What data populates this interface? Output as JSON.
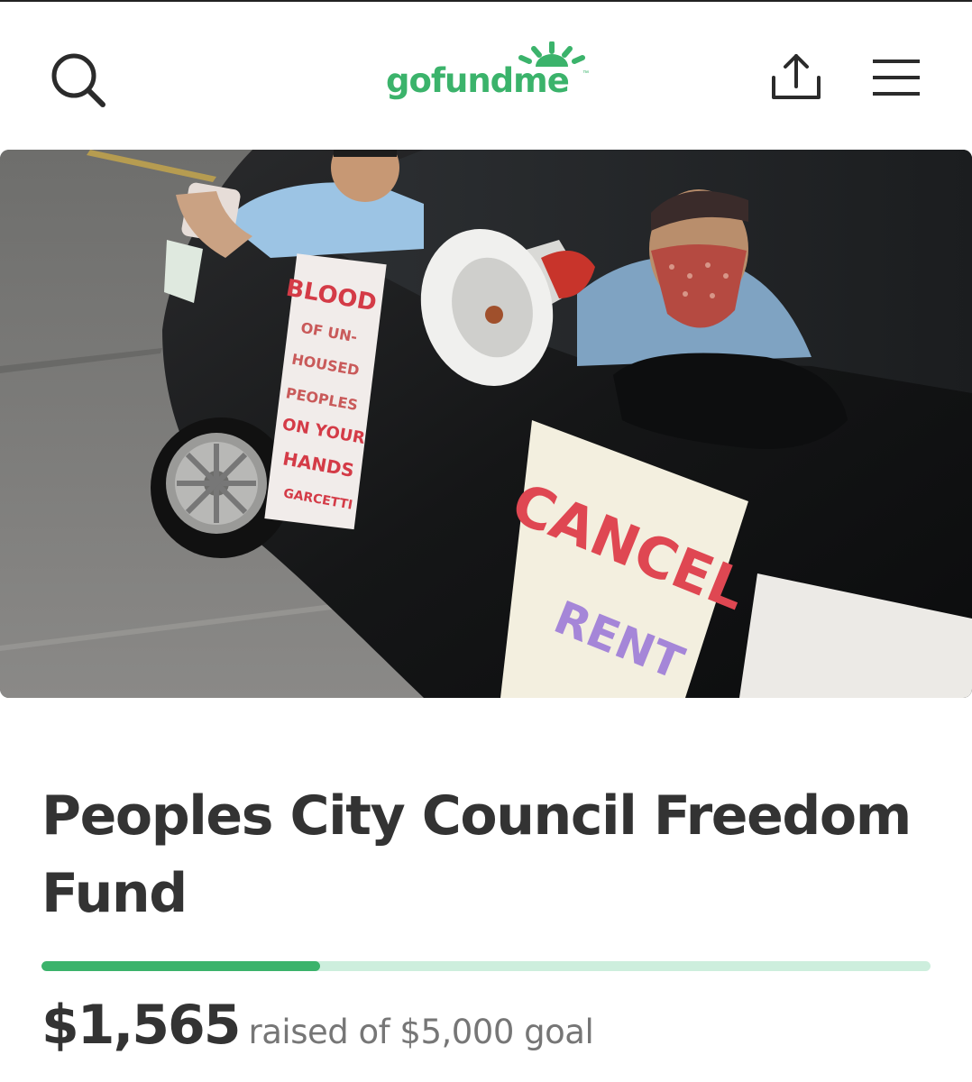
{
  "header": {
    "logo_text": "gofundme",
    "logo_tm": "™",
    "search_icon": "search-icon",
    "share_icon": "share-icon",
    "menu_icon": "hamburger-menu-icon"
  },
  "hero_image": {
    "signs": {
      "left_sign": [
        "BLOOD",
        "OF UN-",
        "HOUSED",
        "PEOPLES",
        "ON YOUR",
        "HANDS",
        "GARCETTI"
      ],
      "right_sign": [
        "CANCEL",
        "RENT"
      ]
    }
  },
  "campaign": {
    "title": "Peoples City Council Freedom Fund",
    "raised_amount": "$1,565",
    "raised_label": "raised of $5,000 goal",
    "progress_fraction": 0.313
  },
  "colors": {
    "brand_green": "#3bb36b",
    "progress_track": "#cdeedd",
    "title_text": "#333333",
    "muted_text": "#767676"
  }
}
